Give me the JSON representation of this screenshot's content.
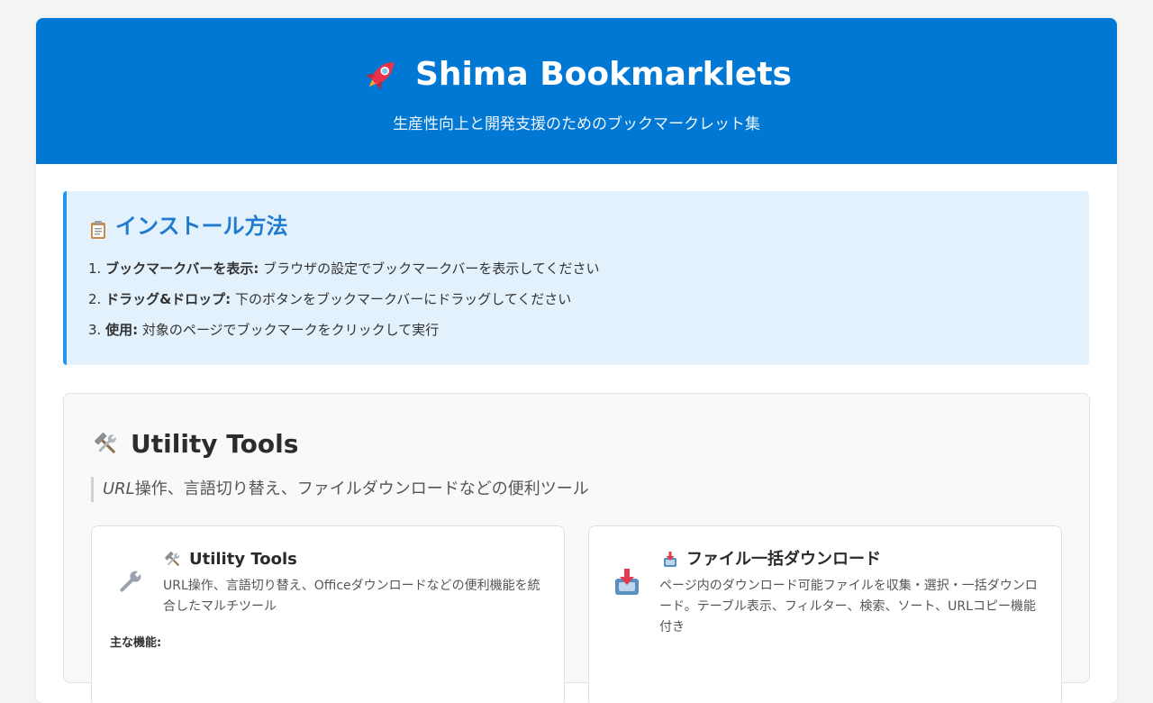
{
  "header": {
    "title": "Shima Bookmarklets",
    "subtitle": "生産性向上と開発支援のためのブックマークレット集",
    "icon": "rocket-icon"
  },
  "install": {
    "title": "インストール方法",
    "icon": "clipboard-icon",
    "steps": [
      {
        "num": "1.",
        "label": "ブックマークバーを表示:",
        "text": " ブラウザの設定でブックマークバーを表示してください"
      },
      {
        "num": "2.",
        "label": "ドラッグ&ドロップ:",
        "text": " 下のボタンをブックマークバーにドラッグしてください"
      },
      {
        "num": "3.",
        "label": "使用:",
        "text": " 対象のページでブックマークをクリックして実行"
      }
    ]
  },
  "section": {
    "title": "Utility Tools",
    "icon": "hammer-wrench-icon",
    "desc_em": "URL",
    "desc_rest": "操作、言語切り替え、ファイルダウンロードなどの便利ツール",
    "cards": [
      {
        "title": "Utility Tools",
        "title_icon": "hammer-wrench-icon",
        "big_icon": "wrench-icon",
        "desc": "URL操作、言語切り替え、Officeダウンロードなどの便利機能を統合したマルチツール",
        "features_label": "主な機能:"
      },
      {
        "title": "ファイル一括ダウンロード",
        "title_icon": "inbox-download-icon",
        "big_icon": "inbox-download-icon",
        "desc": "ページ内のダウンロード可能ファイルを収集・選択・一括ダウンロード。テーブル表示、フィルター、検索、ソート、URLコピー機能付き"
      }
    ]
  },
  "colors": {
    "header_bg": "#0078d4",
    "install_bg": "#e3f1fc",
    "install_accent": "#2196f3",
    "install_title": "#1e7bd0"
  }
}
